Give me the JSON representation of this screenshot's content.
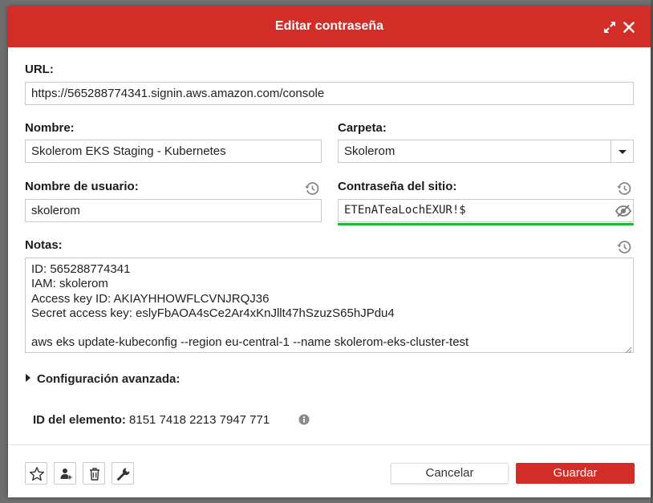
{
  "dialog": {
    "title": "Editar contraseña",
    "accent_color": "#d32d27"
  },
  "fields": {
    "url": {
      "label": "URL:",
      "value": "https://565288774341.signin.aws.amazon.com/console"
    },
    "name": {
      "label": "Nombre:",
      "value": "Skolerom EKS Staging - Kubernetes"
    },
    "folder": {
      "label": "Carpeta:",
      "value": "Skolerom"
    },
    "username": {
      "label": "Nombre de usuario:",
      "value": "skolerom"
    },
    "password": {
      "label": "Contraseña del sitio:",
      "value": "ETEnATeaLochEXUR!$",
      "strength_color": "#1fb637"
    },
    "notes": {
      "label": "Notas:",
      "lines": [
        "ID: 565288774341",
        "IAM: skolerom",
        "Access key ID: AKIAYHHOWFLCVNJRQJ36",
        "Secret access key: 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",
        "",
        "aws eks update-kubeconfig --region eu-central-1 --name skolerom-eks-cluster-test"
      ]
    }
  },
  "advanced": {
    "label": "Configuración avanzada:"
  },
  "element_id": {
    "label": "ID del elemento:",
    "value": "8151 7418 2213 7947 771"
  },
  "footer": {
    "cancel_label": "Cancelar",
    "save_label": "Guardar",
    "icons": [
      "star-icon",
      "share-user-icon",
      "trash-icon",
      "wrench-icon"
    ]
  }
}
